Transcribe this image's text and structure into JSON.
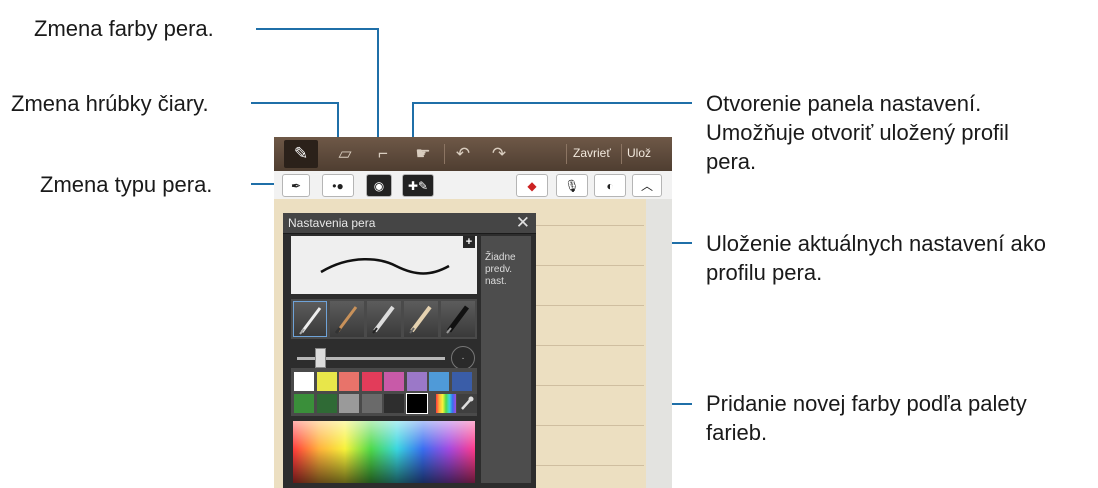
{
  "callouts": {
    "pen_color": "Zmena farby pera.",
    "line_thickness": "Zmena hrúbky čiary.",
    "pen_type": "Zmena typu pera.",
    "open_settings": [
      "Otvorenie panela nastavení.",
      "Umožňuje otvoriť uložený profil",
      "pera."
    ],
    "save_settings": [
      "Uloženie aktuálnych nastavení ako",
      "profilu pera."
    ],
    "add_color": [
      "Pridanie novej farby podľa palety",
      "farieb."
    ]
  },
  "toolbar": {
    "close_label": "Zavrieť",
    "save_label": "Ulož"
  },
  "pen_panel": {
    "title": "Nastavenia pera",
    "presets_label": [
      "Žiadne",
      "predv.",
      "nast."
    ]
  },
  "colors": {
    "leader_line": "#1f6fa8",
    "palette_row1": [
      "#ffffff",
      "#e8e64a",
      "#e8736a",
      "#e23c5a",
      "#c85aa8",
      "#9b78c8",
      "#4f9ad8",
      "#3a5da8"
    ],
    "palette_row2": [
      "#3a8f3a",
      "#2f6a35",
      "#9a9a9a",
      "#6a6a6a",
      "#2e2e2e",
      "#000000"
    ]
  },
  "icons": {
    "pen_mode": "pencil-icon",
    "eraser_mode": "eraser-icon",
    "shape_mode": "shape-icon",
    "hand_mode": "hand-icon",
    "undo": "undo-icon",
    "redo": "redo-icon",
    "pen_type": "pen-type-icon",
    "thickness": "thickness-icon",
    "pen_color": "pen-color-icon",
    "settings": "settings-panel-icon",
    "fill_color": "fill-color-icon",
    "voice": "microphone-icon",
    "background": "background-icon",
    "collapse": "collapse-icon",
    "close": "close-icon",
    "add_preset": "add-preset-icon",
    "eyedropper": "eyedropper-icon"
  }
}
